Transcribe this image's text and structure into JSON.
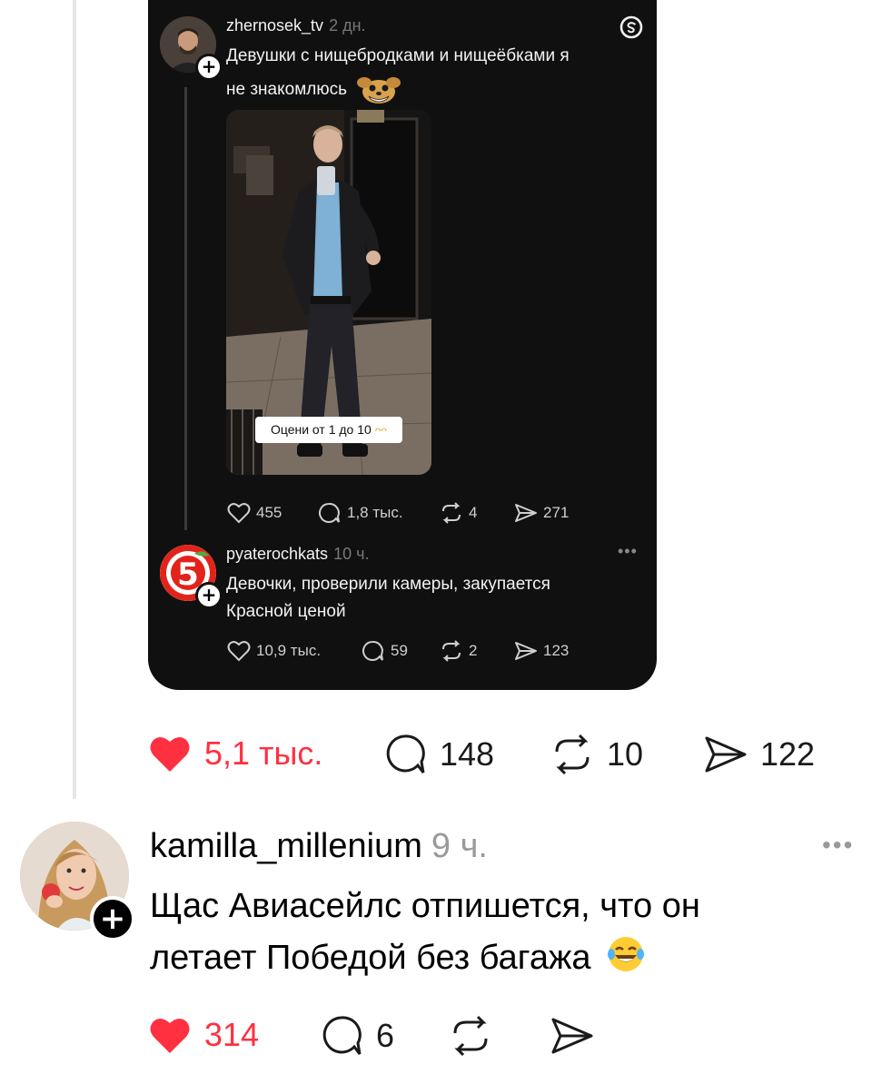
{
  "embedded_post": {
    "author": "zhernosek_tv",
    "time": "2 дн.",
    "text_line1": "Девушки с нищебродками и нищеёбками я",
    "text_line2": "не знакомлюсь",
    "photo_caption": "Оцени от 1 до 10",
    "likes": "455",
    "comments": "1,8 тыс.",
    "reposts": "4",
    "shares": "271"
  },
  "embedded_reply": {
    "author": "pyaterochkats",
    "time": "10 ч.",
    "text_line1": "Девочки, проверили камеры, закупается",
    "text_line2": "Красной ценой",
    "logo_text": "5",
    "likes": "10,9 тыс.",
    "comments": "59",
    "reposts": "2",
    "shares": "123"
  },
  "post_stats": {
    "likes": "5,1 тыс.",
    "comments": "148",
    "reposts": "10",
    "shares": "122"
  },
  "comment": {
    "author": "kamilla_millenium",
    "time": "9 ч.",
    "text_line1": "Щас Авиасейлс отпишется, что он",
    "text_line2": "летает Победой без багажа",
    "likes": "314",
    "comments": "6"
  },
  "colors": {
    "like_red": "#ff3040",
    "card_bg": "#101010",
    "pyaterochka_red": "#e2231a",
    "pyaterochka_green": "#5aa545"
  }
}
